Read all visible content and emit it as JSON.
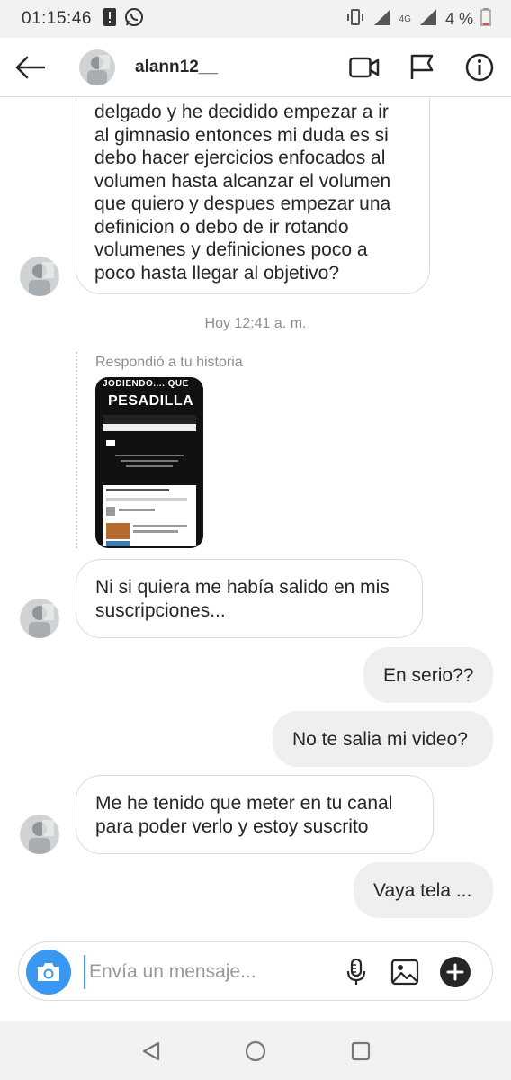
{
  "status_bar": {
    "time": "01:15:46",
    "battery": "4 %",
    "network": "4G",
    "icons": [
      "alert-icon",
      "whatsapp-icon",
      "vibrate-icon",
      "signal-icon",
      "signal-icon",
      "battery-icon"
    ]
  },
  "header": {
    "username": "alann12__",
    "icons": [
      "back-arrow-icon",
      "video-call-icon",
      "flag-icon",
      "info-icon"
    ]
  },
  "messages": {
    "first": {
      "direction": "incoming",
      "lines": [
        "delgado y he decidido empezar a ir",
        "al gimnasio entonces mi duda es si",
        "debo hacer ejercicios enfocados al",
        "volumen hasta alcanzar el volumen",
        "que quiero y despues empezar una",
        "definicion o debo de ir rotando",
        "volumenes y definiciones poco a",
        "poco hasta llegar al objetivo?"
      ]
    },
    "timestamp": "Hoy 12:41 a. m.",
    "story_reply": {
      "label": "Respondió a tu historia",
      "story_title_top": "JODIENDO.... QUE",
      "story_title_main": "PESADILLA"
    },
    "second": {
      "direction": "incoming",
      "lines": [
        "Ni si quiera me había salido en mis",
        "suscripciones..."
      ]
    },
    "third": {
      "direction": "outgoing",
      "text": "En serio??"
    },
    "fourth": {
      "direction": "outgoing",
      "text": "No te salia mi video?"
    },
    "fifth": {
      "direction": "incoming",
      "lines": [
        "Me he tenido que meter en tu canal",
        "para poder verlo y estoy suscrito"
      ]
    },
    "sixth": {
      "direction": "outgoing",
      "text": "Vaya tela ..."
    }
  },
  "composer": {
    "placeholder": "Envía un mensaje...",
    "value": "",
    "icons": [
      "camera-icon",
      "microphone-icon",
      "gallery-icon",
      "add-icon"
    ]
  },
  "nav": {
    "icons": [
      "nav-back-icon",
      "nav-home-icon",
      "nav-recents-icon"
    ]
  },
  "colors": {
    "accent": "#3897f0",
    "incoming_border": "#dbdbdb",
    "outgoing_bg": "#efefef"
  }
}
